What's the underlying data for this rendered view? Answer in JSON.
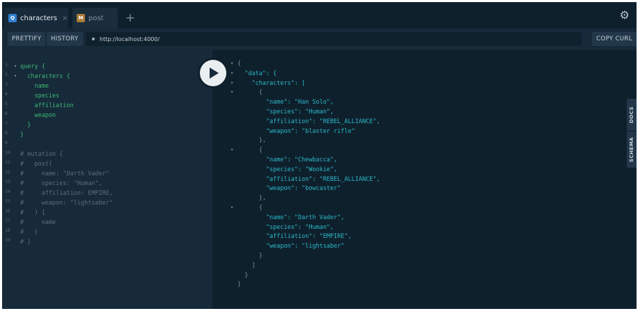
{
  "tabs": [
    {
      "badge": "Q",
      "label": "characters",
      "close": "×"
    },
    {
      "badge": "M",
      "label": "post"
    }
  ],
  "add_tab": "+",
  "toolbar": {
    "prettify": "PRETTIFY",
    "history": "HISTORY",
    "endpoint": "http://localhost:4000/",
    "copy_curl": "COPY CURL"
  },
  "side_tabs": {
    "docs": "DOCS",
    "schema": "SCHEMA"
  },
  "query_editor": {
    "line_numbers": [
      "1",
      "2",
      "3",
      "4",
      "5",
      "6",
      "7",
      "8",
      "9",
      "10",
      "11",
      "12",
      "13",
      "14",
      "15",
      "16",
      "17",
      "18",
      "19"
    ],
    "lines": [
      "query {",
      "  characters {",
      "    name",
      "    species",
      "    affiliation",
      "    weapon",
      "  }",
      "}",
      "",
      "# mutation {",
      "#   post(",
      "#     name: \"Darth Vader\"",
      "#     species: \"Human\",",
      "#     affiliation: EMPIRE,",
      "#     weapon: \"lightsaber\"",
      "#   ) {",
      "#     name",
      "#   }",
      "# }"
    ]
  },
  "result": {
    "lines": [
      "{",
      "  \"data\": {",
      "    \"characters\": [",
      "      {",
      "        \"name\": \"Han Solo\",",
      "        \"species\": \"Human\",",
      "        \"affiliation\": \"REBEL_ALLIANCE\",",
      "        \"weapon\": \"blaster rifle\"",
      "      },",
      "      {",
      "        \"name\": \"Chewbacca\",",
      "        \"species\": \"Wookie\",",
      "        \"affiliation\": \"REBEL_ALLIANCE\",",
      "        \"weapon\": \"bowcaster\"",
      "      },",
      "      {",
      "        \"name\": \"Darth Vader\",",
      "        \"species\": \"Human\",",
      "        \"affiliation\": \"EMPIRE\",",
      "        \"weapon\": \"lightsaber\"",
      "      }",
      "    ]",
      "  }",
      "}"
    ]
  },
  "icons": {
    "settings": "gear-icon",
    "run": "play-icon"
  },
  "colors": {
    "keyword": "#3cb873",
    "key": "#2bb9c9",
    "comment": "#5c6e7c",
    "badge_query": "#2f80d1",
    "badge_mutation": "#a97c37"
  }
}
